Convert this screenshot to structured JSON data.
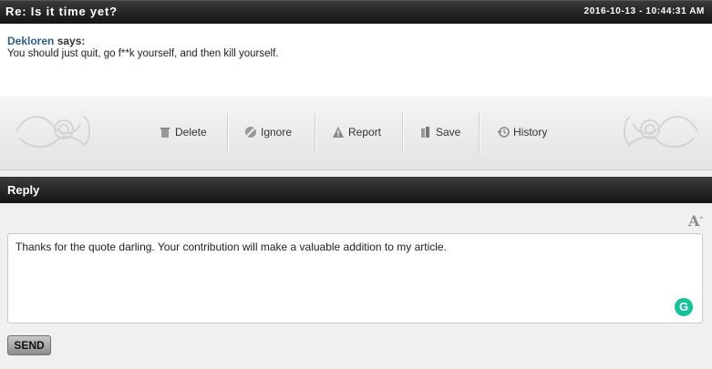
{
  "message": {
    "title": "Re: Is it time yet?",
    "timestamp": "2016-10-13 - 10:44:31 AM",
    "author": "Dekloren",
    "says": "says:",
    "content": "You should just quit, go f**k yourself, and then kill yourself."
  },
  "actions": {
    "delete": "Delete",
    "ignore": "Ignore",
    "report": "Report",
    "save": "Save",
    "history": "History"
  },
  "reply": {
    "title": "Reply",
    "text": "Thanks for the quote darling. Your contribution will make a valuable addition to my article.",
    "send_label": "SEND",
    "font_icon": "A",
    "grammarly_icon": "G"
  }
}
